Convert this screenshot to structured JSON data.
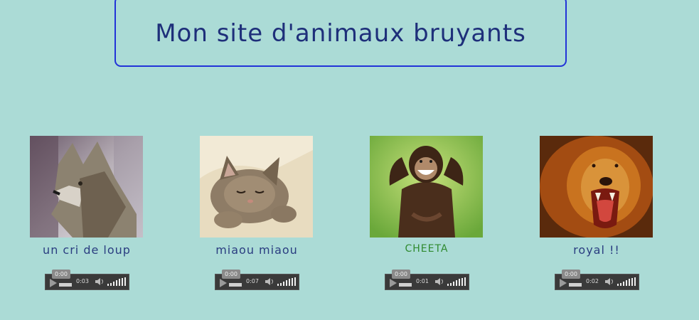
{
  "header": {
    "title": "Mon site d'animaux bruyants"
  },
  "animals": [
    {
      "name": "wolf",
      "caption": "un cri de loup",
      "player": {
        "current": "0:00",
        "duration": "0:03"
      }
    },
    {
      "name": "kitten",
      "caption": "miaou miaou",
      "player": {
        "current": "0:00",
        "duration": "0:07"
      }
    },
    {
      "name": "chimp",
      "caption": "CHEETA",
      "player": {
        "current": "0:00",
        "duration": "0:01"
      }
    },
    {
      "name": "lion",
      "caption": "royal !!",
      "player": {
        "current": "0:00",
        "duration": "0:02"
      }
    }
  ],
  "colors": {
    "background": "#abdbd6",
    "title_border": "#2233d8",
    "title_text": "#1e2f7a",
    "caption_blue": "#2a3d80",
    "caption_green": "#2f8a2f"
  },
  "icons": [
    "play-icon",
    "volume-icon",
    "volume-level-icon"
  ]
}
